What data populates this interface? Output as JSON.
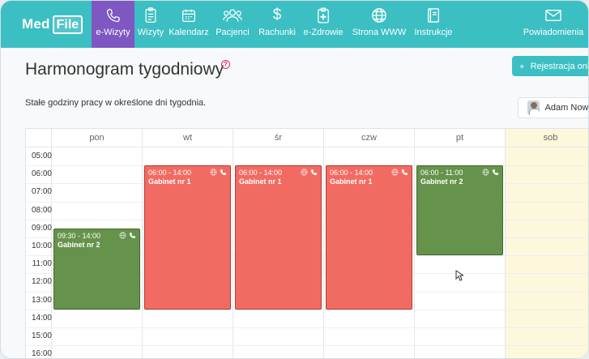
{
  "app": {
    "logo_part1": "Med",
    "logo_part2": "File",
    "brand_color": "#3bbfc3",
    "active_color": "#7e57c2"
  },
  "nav": {
    "items": [
      {
        "label": "e-Wizyty",
        "icon": "phone-icon",
        "active": true
      },
      {
        "label": "Wizyty",
        "icon": "clipboard-icon"
      },
      {
        "label": "Kalendarz",
        "icon": "calendar-icon"
      },
      {
        "label": "Pacjenci",
        "icon": "users-icon"
      },
      {
        "label": "Rachunki",
        "icon": "dollar-icon"
      },
      {
        "label": "e-Zdrowie",
        "icon": "medical-plus-icon"
      },
      {
        "label": "Strona WWW",
        "icon": "globe-icon"
      },
      {
        "label": "Instrukcje",
        "icon": "book-icon"
      }
    ],
    "notifications": {
      "label": "Powiadomienia",
      "icon": "envelope-icon"
    }
  },
  "page": {
    "title": "Harmonogram tygodniowy",
    "help": "?",
    "subtitle": "Stałe godziny pracy w określone dni tygodnia.",
    "register_button": "Rejestracja online",
    "user_name": "Adam Nowak"
  },
  "calendar": {
    "days": [
      "pon",
      "wt",
      "śr",
      "czw",
      "pt",
      "sob"
    ],
    "hours": [
      "05:00",
      "06:00",
      "07:00",
      "08:00",
      "09:00",
      "10:00",
      "11:00",
      "12:00",
      "13:00",
      "14:00",
      "15:00",
      "16:00"
    ],
    "events": [
      {
        "day": 0,
        "start": 9.5,
        "end": 14,
        "time": "09:30 - 14:00",
        "room": "Gabinet nr 2",
        "color": "green"
      },
      {
        "day": 1,
        "start": 6,
        "end": 14,
        "time": "06:00 - 14:00",
        "room": "Gabinet nr 1",
        "color": "red"
      },
      {
        "day": 2,
        "start": 6,
        "end": 14,
        "time": "06:00 - 14:00",
        "room": "Gabinet nr 1",
        "color": "red"
      },
      {
        "day": 3,
        "start": 6,
        "end": 14,
        "time": "06:00 - 14:00",
        "room": "Gabinet nr 1",
        "color": "red"
      },
      {
        "day": 4,
        "start": 6,
        "end": 11,
        "time": "06:00 - 11:00",
        "room": "Gabinet nr 2",
        "color": "green"
      }
    ]
  }
}
